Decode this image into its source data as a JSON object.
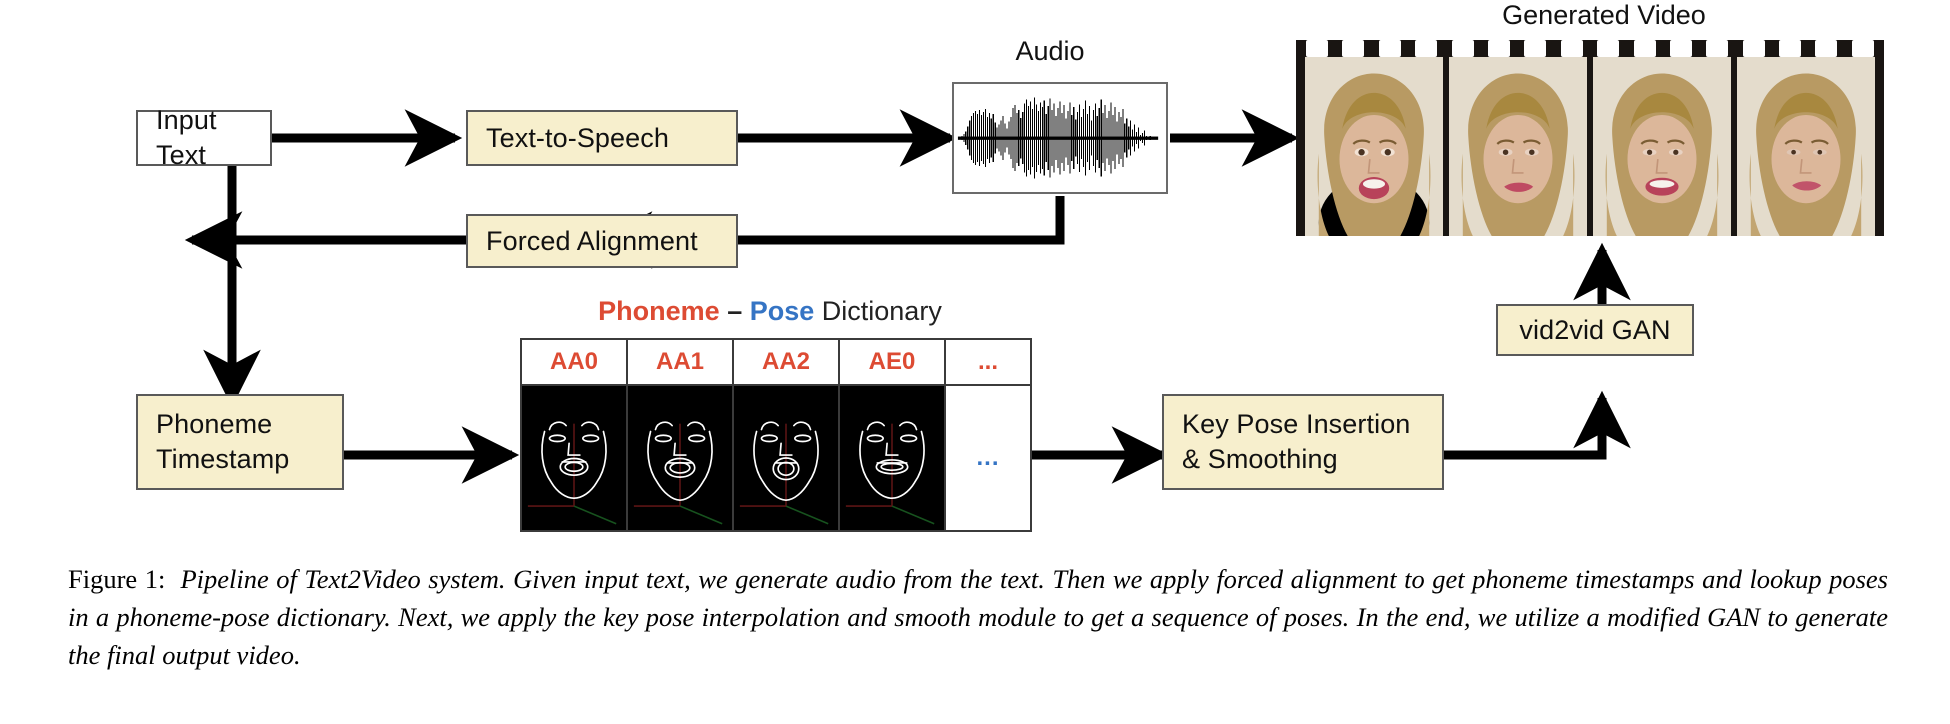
{
  "figure": {
    "label": "Figure 1:",
    "caption": "Pipeline of Text2Video system. Given input text, we generate audio from the text. Then we apply forced alignment to get phoneme timestamps and lookup poses in a phoneme-pose dictionary. Next, we apply the key pose interpolation and smooth module to get a sequence of poses. In the end, we utilize a modified GAN to generate the final output video."
  },
  "nodes": {
    "input_text": "Input Text",
    "text_to_speech": "Text-to-Speech",
    "forced_alignment": "Forced Alignment",
    "phoneme_timestamp_line1": "Phoneme",
    "phoneme_timestamp_line2": "Timestamp",
    "key_pose_line1": "Key Pose Insertion",
    "key_pose_line2": "& Smoothing",
    "vid2vid_gan": "vid2vid GAN"
  },
  "labels": {
    "audio": "Audio",
    "generated_video": "Generated Video"
  },
  "dictionary": {
    "title_phoneme": "Phoneme",
    "title_dash": " – ",
    "title_pose": "Pose",
    "title_suffix": " Dictionary",
    "headers": [
      "AA0",
      "AA1",
      "AA2",
      "AE0",
      "..."
    ],
    "overflow_cell": "..."
  },
  "colors": {
    "box_fill": "#f7efcd",
    "box_border": "#595959",
    "phoneme_red": "#dd4b33",
    "pose_blue": "#3574c4",
    "arrow_black": "#000000",
    "film_black": "#191512",
    "pose_cell_black": "#000000"
  }
}
